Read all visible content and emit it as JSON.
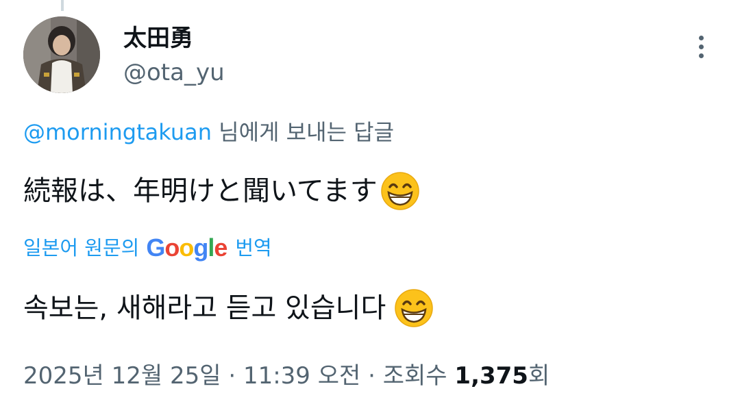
{
  "author": {
    "display_name": "太田勇",
    "handle": "@ota_yu",
    "avatar_icon": "profile-photo"
  },
  "reply_context": {
    "mention": "@morningtakuan",
    "suffix": " 님에게 보내는 답글"
  },
  "tweet": {
    "text": "続報は、年明けと聞いてます",
    "emoji": "grinning-face-with-smiling-eyes"
  },
  "translation": {
    "prefix": "일본어 원문의",
    "google_logo": [
      "G",
      "o",
      "o",
      "g",
      "l",
      "e"
    ],
    "suffix": "번역",
    "text": "속보는, 새해라고 듣고 있습니다"
  },
  "meta": {
    "date": "2025년 12월 25일",
    "separator": " · ",
    "time": "11:39 오전",
    "views_label": "조회수 ",
    "views_count": "1,375",
    "views_suffix": "회"
  },
  "colors": {
    "link": "#1d9bf0",
    "secondary": "#536471",
    "primary": "#0f1419",
    "thread_line": "#cfd9de"
  },
  "icons": {
    "more": "more-vertical-icon"
  }
}
